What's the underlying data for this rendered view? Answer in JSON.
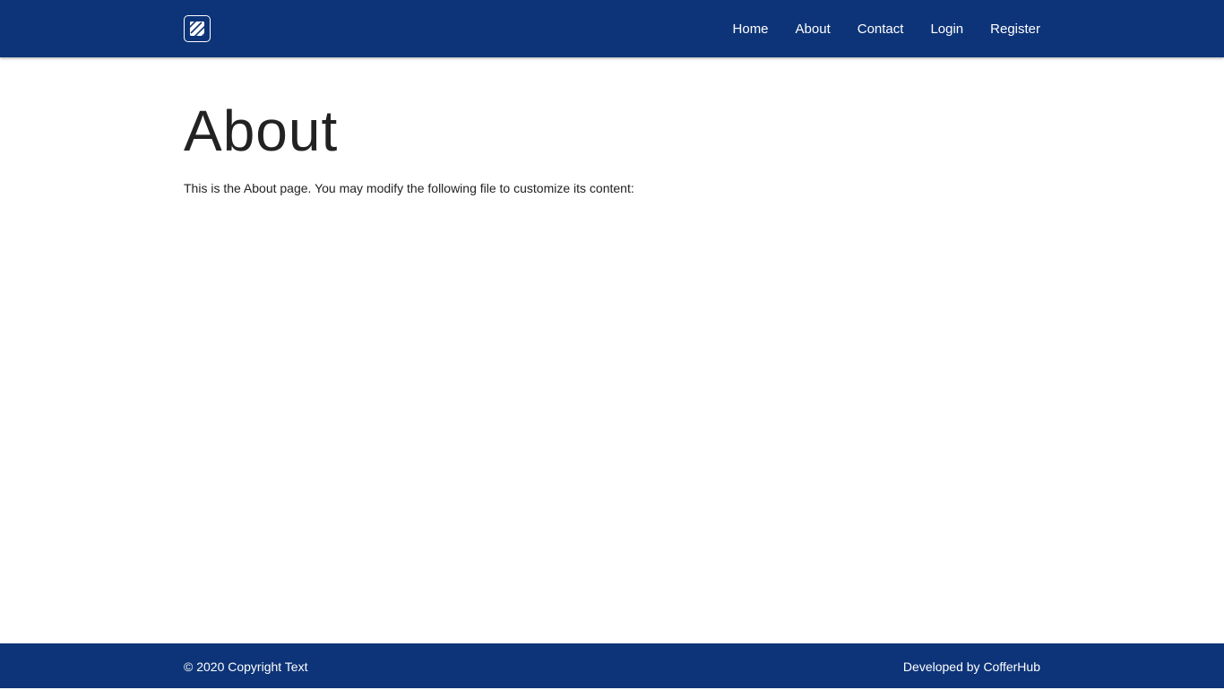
{
  "header": {
    "logo_icon": "brand-logo-icon",
    "nav": [
      {
        "label": "Home"
      },
      {
        "label": "About"
      },
      {
        "label": "Contact"
      },
      {
        "label": "Login"
      },
      {
        "label": "Register"
      }
    ]
  },
  "main": {
    "title": "About",
    "body": "This is the About page. You may modify the following file to customize its content:"
  },
  "footer": {
    "copyright": "© 2020 Copyright Text",
    "developed_by_prefix": "Developed by ",
    "developer": "CofferHub"
  },
  "colors": {
    "primary": "#0d3478",
    "text": "#222222",
    "background": "#ffffff"
  }
}
